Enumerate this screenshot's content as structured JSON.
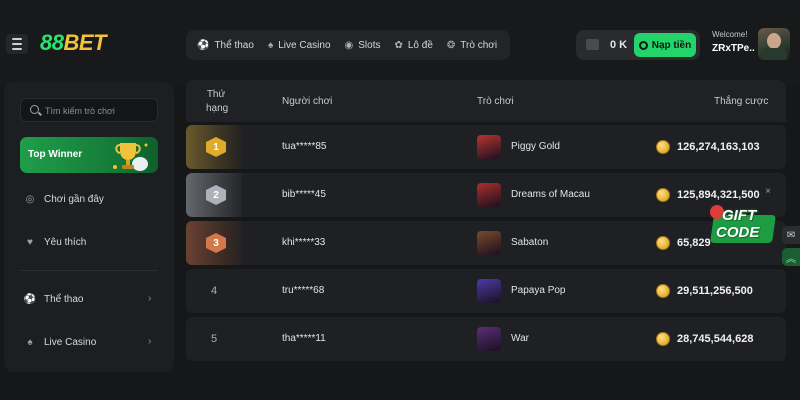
{
  "brand": {
    "logo_a": "88",
    "logo_b": "BET"
  },
  "nav": [
    {
      "label": "Thể thao",
      "icon": "soccer-ball-icon"
    },
    {
      "label": "Live Casino",
      "icon": "casino-chip-icon"
    },
    {
      "label": "Slots",
      "icon": "slot-icon"
    },
    {
      "label": "Lô đề",
      "icon": "lottery-icon"
    },
    {
      "label": "Trò chơi",
      "icon": "game-icon"
    }
  ],
  "wallet": {
    "balance": "0 K",
    "deposit_label": "Nạp tiền"
  },
  "user": {
    "welcome": "Welcome!",
    "name": "ZRxTPe.."
  },
  "sidebar": {
    "search_placeholder": "Tìm kiếm trò chơi",
    "top_winner": "Top Winner",
    "items": [
      {
        "label": "Chơi gần đây",
        "icon": "recent-icon"
      },
      {
        "label": "Yêu thích",
        "icon": "heart-icon"
      },
      {
        "label": "Thể thao",
        "icon": "soccer-ball-icon"
      },
      {
        "label": "Live Casino",
        "icon": "casino-chip-icon"
      }
    ]
  },
  "leaderboard": {
    "headers": {
      "rank_line1": "Thứ",
      "rank_line2": "hạng",
      "player": "Người chơi",
      "game": "Trò chơi",
      "winnings": "Thắng cược"
    },
    "rows": [
      {
        "rank": "1",
        "player": "tua*****85",
        "game": "Piggy Gold",
        "amount": "126,274,163,103",
        "thumb_color": "#b8342f"
      },
      {
        "rank": "2",
        "player": "bib*****45",
        "game": "Dreams of Macau",
        "amount": "125,894,321,500",
        "thumb_color": "#a8302c"
      },
      {
        "rank": "3",
        "player": "khi*****33",
        "game": "Sabaton",
        "amount": "65,829",
        "thumb_color": "#7a4a2a"
      },
      {
        "rank": "4",
        "player": "tru*****68",
        "game": "Papaya Pop",
        "amount": "29,511,256,500",
        "thumb_color": "#4c3aa8"
      },
      {
        "rank": "5",
        "player": "tha*****11",
        "game": "War",
        "amount": "28,745,544,628",
        "thumb_color": "#5a2f7a"
      }
    ]
  },
  "gift": {
    "line1": "GIFT",
    "line2": "CODE",
    "close": "×"
  },
  "colors": {
    "accent": "#23d46a",
    "gold": "#e1aa2b",
    "silver": "#aeb2ba",
    "bronze": "#d2784a"
  }
}
